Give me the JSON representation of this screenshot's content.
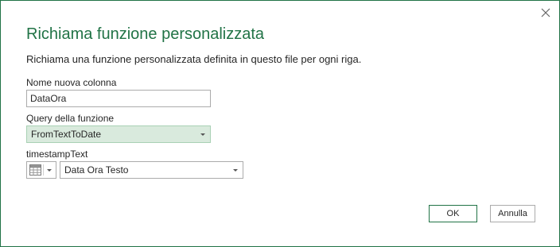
{
  "dialog": {
    "title": "Richiama funzione personalizzata",
    "description": "Richiama una funzione personalizzata definita in questo file per ogni riga.",
    "close_icon": "close-icon"
  },
  "new_column": {
    "label": "Nome nuova colonna",
    "value": "DataOra"
  },
  "function_query": {
    "label": "Query della funzione",
    "selected": "FromTextToDate"
  },
  "parameter": {
    "label": "timestampText",
    "type_icon": "table-column-icon",
    "selected": "Data Ora Testo"
  },
  "buttons": {
    "ok": "OK",
    "cancel": "Annulla"
  },
  "colors": {
    "accent": "#217346",
    "selected_fill": "#d9eadd",
    "border": "#ababab"
  }
}
